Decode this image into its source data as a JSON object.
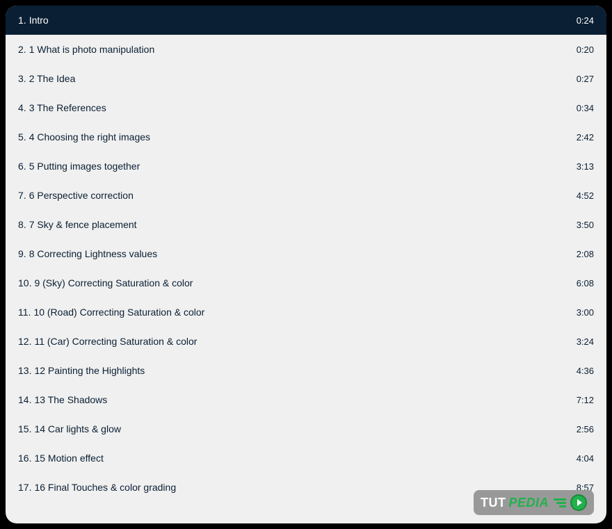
{
  "watermark": {
    "text1": "TUT",
    "text2": "PEDIA"
  },
  "items": [
    {
      "number": "1.",
      "title": "Intro",
      "duration": "0:24",
      "active": true
    },
    {
      "number": "2.",
      "title": "1 What is photo manipulation",
      "duration": "0:20",
      "active": false
    },
    {
      "number": "3.",
      "title": "2 The Idea",
      "duration": "0:27",
      "active": false
    },
    {
      "number": "4.",
      "title": "3 The References",
      "duration": "0:34",
      "active": false
    },
    {
      "number": "5.",
      "title": "4 Choosing the right images",
      "duration": "2:42",
      "active": false
    },
    {
      "number": "6.",
      "title": "5 Putting images together",
      "duration": "3:13",
      "active": false
    },
    {
      "number": "7.",
      "title": "6 Perspective correction",
      "duration": "4:52",
      "active": false
    },
    {
      "number": "8.",
      "title": "7 Sky & fence placement",
      "duration": "3:50",
      "active": false
    },
    {
      "number": "9.",
      "title": "8 Correcting Lightness values",
      "duration": "2:08",
      "active": false
    },
    {
      "number": "10.",
      "title": "9 (Sky) Correcting Saturation & color",
      "duration": "6:08",
      "active": false
    },
    {
      "number": "11.",
      "title": "10 (Road) Correcting Saturation & color",
      "duration": "3:00",
      "active": false
    },
    {
      "number": "12.",
      "title": "11 (Car) Correcting Saturation & color",
      "duration": "3:24",
      "active": false
    },
    {
      "number": "13.",
      "title": "12 Painting the Highlights",
      "duration": "4:36",
      "active": false
    },
    {
      "number": "14.",
      "title": "13 The Shadows",
      "duration": "7:12",
      "active": false
    },
    {
      "number": "15.",
      "title": "14 Car lights & glow",
      "duration": "2:56",
      "active": false
    },
    {
      "number": "16.",
      "title": "15 Motion effect",
      "duration": "4:04",
      "active": false
    },
    {
      "number": "17.",
      "title": "16 Final Touches & color grading",
      "duration": "8:57",
      "active": false
    }
  ]
}
